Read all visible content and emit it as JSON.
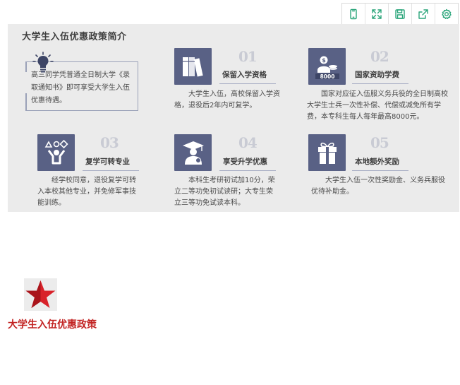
{
  "toolbar": {
    "buttons": [
      {
        "name": "mobile-preview-button",
        "icon": "phone-icon"
      },
      {
        "name": "fullscreen-button",
        "icon": "expand-icon"
      },
      {
        "name": "save-button",
        "icon": "floppy-icon"
      },
      {
        "name": "share-button",
        "icon": "share-icon"
      },
      {
        "name": "settings-button",
        "icon": "gear-icon"
      }
    ],
    "accent_color": "#2aa57a"
  },
  "infographic": {
    "title": "大学生入伍优惠政策简介",
    "intro": "高三同学凭普通全日制大学《录取通知书》即可享受大学生入伍优惠待遇。",
    "items": [
      {
        "num": "01",
        "label": "保留入学资格",
        "desc": "大学生入伍，高校保留入学资格，退役后2年内可复学。"
      },
      {
        "num": "02",
        "label": "国家资助学费",
        "desc": "国家对应征入伍服义务兵役的全日制高校大学生士兵一次性补偿、代偿或减免所有学费，本专科生每人每年最高8000元。",
        "icon_caption": "8000"
      },
      {
        "num": "03",
        "label": "复学可转专业",
        "desc": "经学校同意，退役复学可转入本校其他专业，并免修军事技能训练。"
      },
      {
        "num": "04",
        "label": "享受升学优惠",
        "desc": "本科生考研初试加10分，荣立二等功免初试读研；大专生荣立三等功免试读本科。"
      },
      {
        "num": "05",
        "label": "本地额外奖励",
        "desc": "大学生入伍一次性奖励金、义务兵服役优待补助金。"
      }
    ],
    "icon_bg": "#596185"
  },
  "section": {
    "title": "大学生入伍优惠政策",
    "title_color": "#c22322",
    "badge_icon": "red-star-icon"
  }
}
